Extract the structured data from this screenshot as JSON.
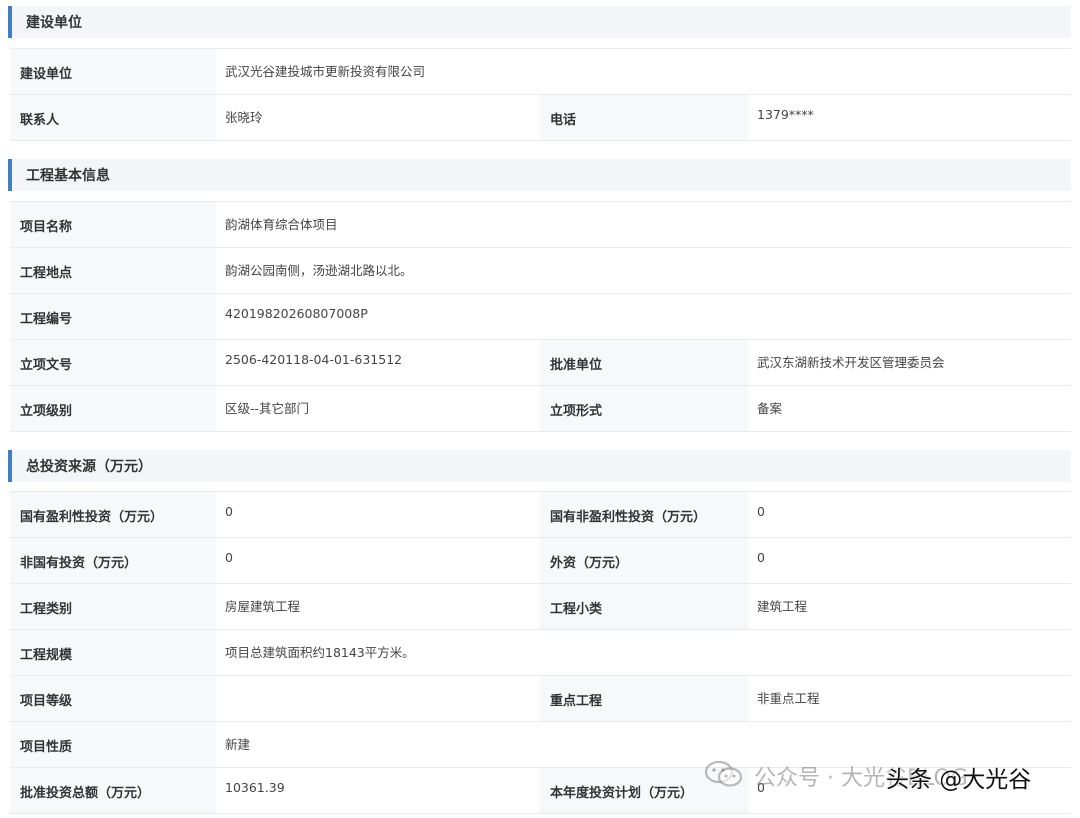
{
  "sections": [
    {
      "title": "建设单位",
      "rows": [
        [
          {
            "label": "建设单位",
            "value": "武汉光谷建投城市更新投资有限公司",
            "wide": true
          }
        ],
        [
          {
            "label": "联系人",
            "value": "张晓玲"
          },
          {
            "label": "电话",
            "value": "1379****"
          }
        ]
      ]
    },
    {
      "title": "工程基本信息",
      "rows": [
        [
          {
            "label": "项目名称",
            "value": "韵湖体育综合体项目",
            "wide": true
          }
        ],
        [
          {
            "label": "工程地点",
            "value": "韵湖公园南侧，汤逊湖北路以北。",
            "wide": true
          }
        ],
        [
          {
            "label": "工程编号",
            "value": "42019820260807008P",
            "wide": true
          }
        ],
        [
          {
            "label": "立项文号",
            "value": "2506-420118-04-01-631512"
          },
          {
            "label": "批准单位",
            "value": "武汉东湖新技术开发区管理委员会"
          }
        ],
        [
          {
            "label": "立项级别",
            "value": "区级--其它部门"
          },
          {
            "label": "立项形式",
            "value": "备案"
          }
        ]
      ]
    },
    {
      "title": "总投资来源（万元）",
      "rows": [
        [
          {
            "label": "国有盈利性投资（万元）",
            "value": "0"
          },
          {
            "label": "国有非盈利性投资（万元）",
            "value": "0"
          }
        ],
        [
          {
            "label": "非国有投资（万元）",
            "value": "0"
          },
          {
            "label": "外资（万元）",
            "value": "0"
          }
        ],
        [
          {
            "label": "工程类别",
            "value": "房屋建筑工程"
          },
          {
            "label": "工程小类",
            "value": "建筑工程"
          }
        ],
        [
          {
            "label": "工程规模",
            "value": "项目总建筑面积约18143平方米。",
            "wide": true
          }
        ],
        [
          {
            "label": "项目等级",
            "value": ""
          },
          {
            "label": "重点工程",
            "value": "非重点工程"
          }
        ],
        [
          {
            "label": "项目性质",
            "value": "新建",
            "wide": true
          }
        ],
        [
          {
            "label": "批准投资总额（万元）",
            "value": "10361.39"
          },
          {
            "label": "本年度投资计划（万元）",
            "value": "0"
          }
        ]
      ]
    }
  ],
  "watermark": {
    "gongzhonghao": "公众号 · 大光谷BLOG",
    "toutiao": "头条 @大光谷"
  },
  "colors": {
    "accent": "#3f7fc2",
    "section_bg": "#f3f5f8",
    "label_bg": "#f7f8fa",
    "border": "#e6e9ee"
  }
}
